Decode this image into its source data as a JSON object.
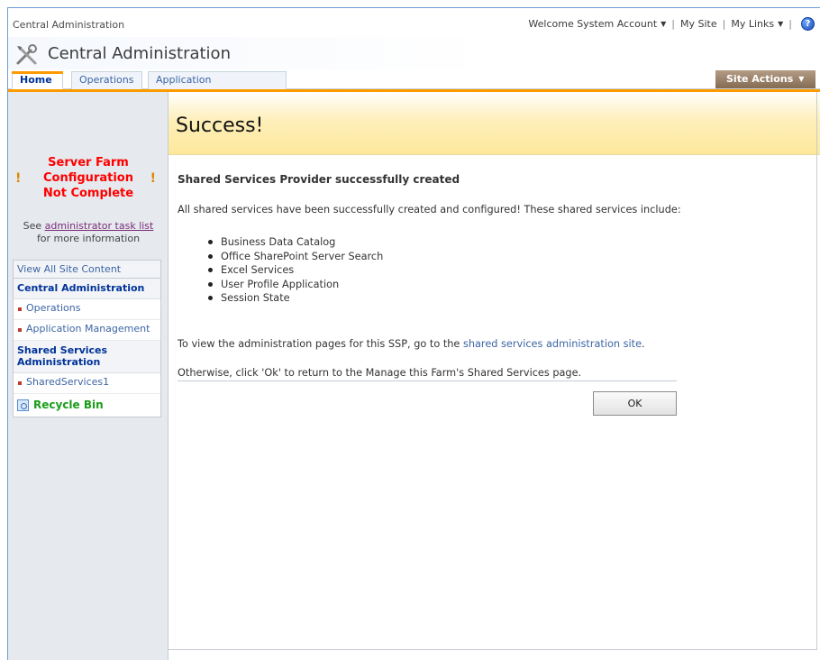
{
  "global": {
    "site_name": "Central Administration",
    "welcome": "Welcome System Account",
    "my_site": "My Site",
    "my_links": "My Links",
    "separator": "|",
    "help_glyph": "?"
  },
  "title": {
    "text": "Central Administration",
    "icon": "tools-icon"
  },
  "tabs": [
    {
      "label": "Home",
      "active": true
    },
    {
      "label": "Operations",
      "active": false
    },
    {
      "label": "Application Management",
      "active": false
    }
  ],
  "site_actions": {
    "label": "Site Actions"
  },
  "sidebar": {
    "alert": {
      "line1": "Server Farm",
      "line2": "Configuration",
      "line3": "Not Complete",
      "icon_glyph": "!"
    },
    "see_prefix": "See",
    "task_link": "administrator task list",
    "see_suffix": "for more information",
    "view_all": "View All Site Content",
    "sections": [
      {
        "heading": "Central Administration",
        "items": [
          "Operations",
          "Application Management"
        ]
      },
      {
        "heading": "Shared Services Administration",
        "items": [
          "SharedServices1"
        ]
      }
    ],
    "recycle_bin": "Recycle Bin"
  },
  "page": {
    "title": "Success!",
    "heading": "Shared Services Provider successfully created",
    "description": "All shared services have been successfully created and configured! These shared services include:",
    "services": [
      "Business Data Catalog",
      "Office SharePoint Server Search",
      "Excel Services",
      "User Profile Application",
      "Session State"
    ],
    "view_prefix": "To view the administration pages for this SSP, go to the",
    "view_link": "shared services administration site",
    "view_suffix": ".",
    "otherwise": "Otherwise, click 'Ok' to return to the Manage this Farm's Shared Services page.",
    "ok_label": "OK"
  },
  "colors": {
    "accent_orange": "#fc9b00",
    "link_blue": "#3c65a4",
    "alert_red": "#ff0000",
    "recycle_green": "#1b9c1b",
    "site_actions_brown": "#846b53"
  }
}
